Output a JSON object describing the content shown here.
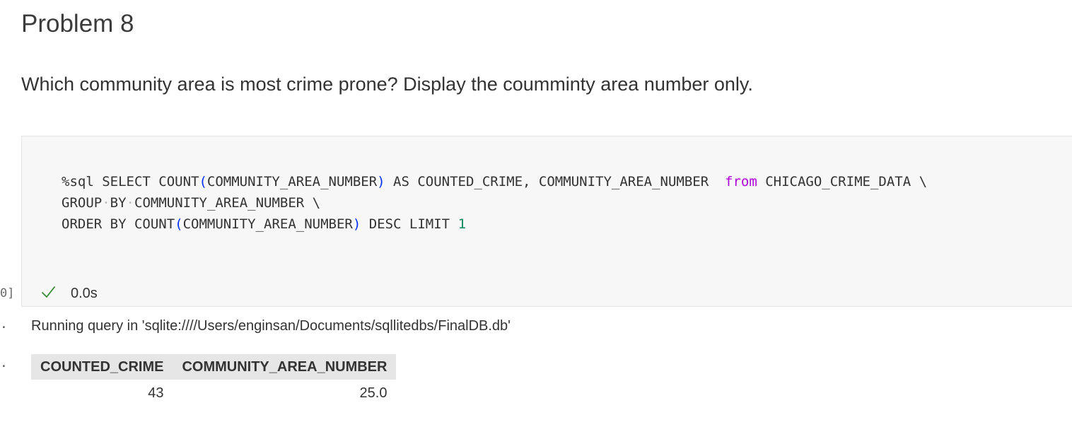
{
  "markdown": {
    "heading": "Problem 8",
    "question": "Which community area is most crime prone? Display the coumminty area number only."
  },
  "code_cell": {
    "execution_count": "0]",
    "status_time": "0.0s",
    "line1": {
      "a": "%sql SELECT COUNT",
      "p1": "(",
      "b": "COMMUNITY_AREA_NUMBER",
      "p2": ")",
      "c": " AS COUNTED_CRIME, COMMUNITY_AREA_NUMBER  ",
      "kw": "from",
      "d": " CHICAGO_CRIME_DATA \\"
    },
    "line2": {
      "a": "GROUP",
      "dot1": "·",
      "b": "BY",
      "dot2": "·",
      "c": "COMMUNITY_AREA_NUMBER \\"
    },
    "line3": {
      "a": "ORDER BY COUNT",
      "p1": "(",
      "b": "COMMUNITY_AREA_NUMBER",
      "p2": ")",
      "c": " DESC LIMIT ",
      "num": "1"
    }
  },
  "output": {
    "marker": ".",
    "running_text": "Running query in 'sqlite:////Users/enginsan/Documents/sqllitedbs/FinalDB.db'",
    "table": {
      "headers": [
        "COUNTED_CRIME",
        "COMMUNITY_AREA_NUMBER"
      ],
      "rows": [
        [
          "43",
          "25.0"
        ]
      ]
    }
  },
  "colors": {
    "paren": "#0431fa",
    "keyword": "#af00db",
    "number": "#098658",
    "success": "#388a34"
  }
}
